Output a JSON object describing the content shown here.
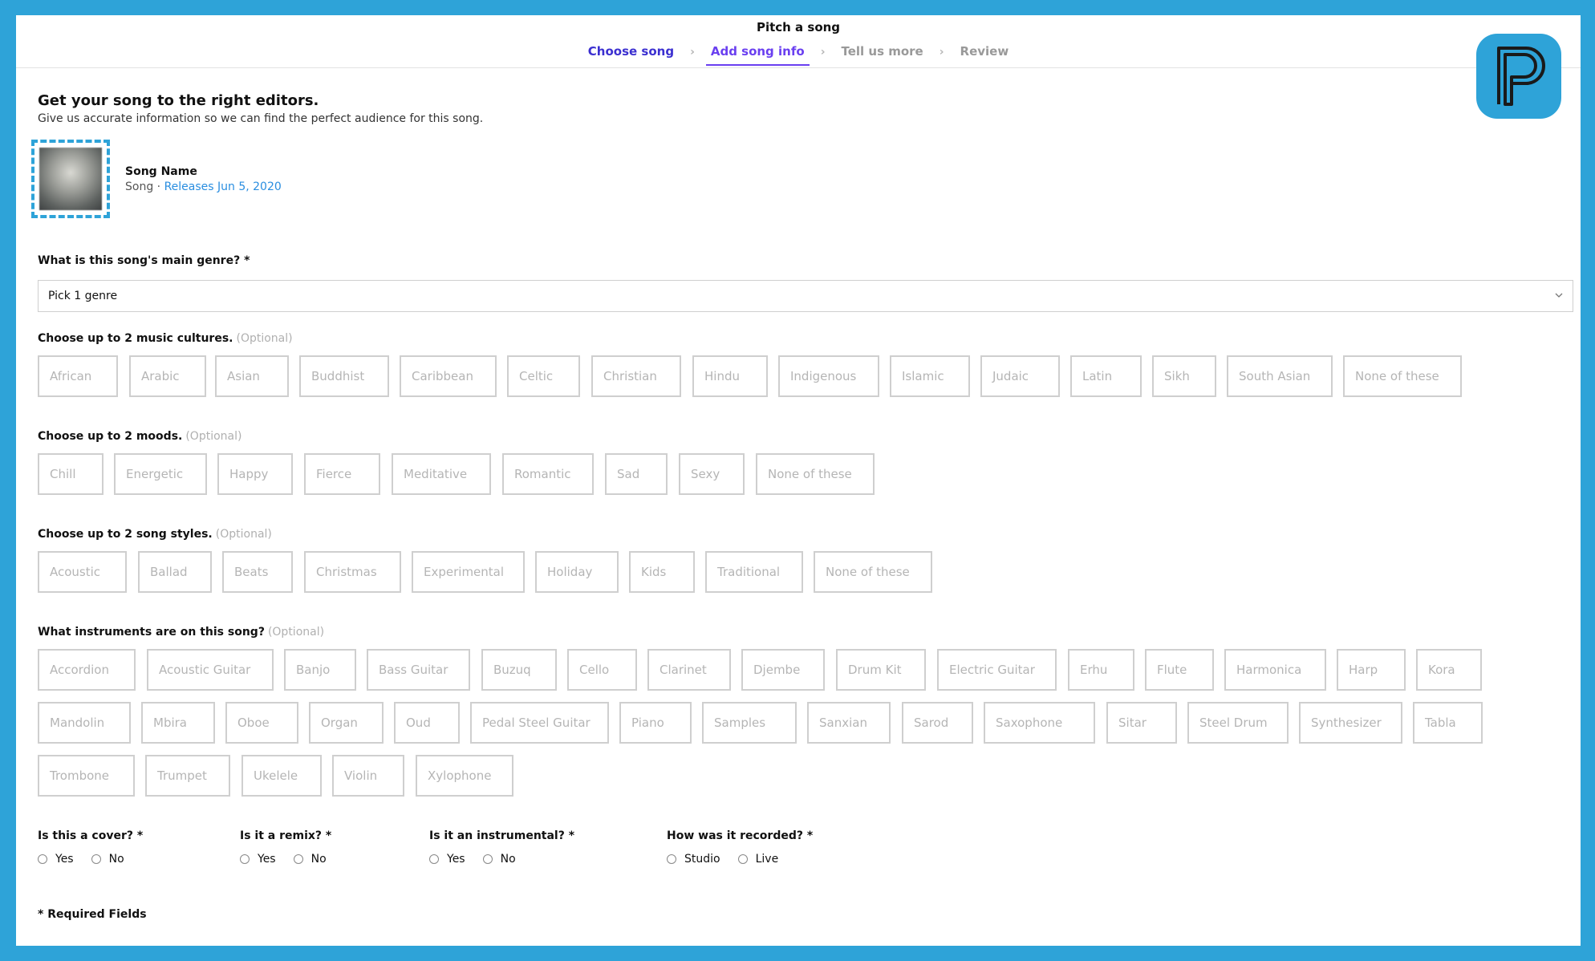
{
  "header": {
    "title": "Pitch a song",
    "steps": [
      {
        "label": "Choose song",
        "state": "done"
      },
      {
        "label": "Add song info",
        "state": "active"
      },
      {
        "label": "Tell us more",
        "state": "todo"
      },
      {
        "label": "Review",
        "state": "todo"
      }
    ]
  },
  "intro": {
    "heading": "Get your song to the right editors.",
    "subheading": "Give us accurate information so we can find the perfect audience for this song."
  },
  "song": {
    "name": "Song Name",
    "type": "Song · ",
    "release": "Releases Jun 5, 2020"
  },
  "genre": {
    "label": "What is this song's main genre? *",
    "placeholder": "Pick 1 genre"
  },
  "cultures": {
    "label": "Choose up to 2 music cultures.",
    "optional": "(Optional)",
    "options": [
      "African",
      "Arabic",
      "Asian",
      "Buddhist",
      "Caribbean",
      "Celtic",
      "Christian",
      "Hindu",
      "Indigenous",
      "Islamic",
      "Judaic",
      "Latin",
      "Sikh",
      "South Asian",
      "None of these"
    ]
  },
  "moods": {
    "label": "Choose up to 2 moods.",
    "optional": "(Optional)",
    "options": [
      "Chill",
      "Energetic",
      "Happy",
      "Fierce",
      "Meditative",
      "Romantic",
      "Sad",
      "Sexy",
      "None of these"
    ]
  },
  "styles": {
    "label": "Choose up to 2 song styles.",
    "optional": "(Optional)",
    "options": [
      "Acoustic",
      "Ballad",
      "Beats",
      "Christmas",
      "Experimental",
      "Holiday",
      "Kids",
      "Traditional",
      "None of these"
    ]
  },
  "instruments": {
    "label": "What instruments are on this song?",
    "optional": "(Optional)",
    "options": [
      "Accordion",
      "Acoustic Guitar",
      "Banjo",
      "Bass Guitar",
      "Buzuq",
      "Cello",
      "Clarinet",
      "Djembe",
      "Drum Kit",
      "Electric Guitar",
      "Erhu",
      "Flute",
      "Harmonica",
      "Harp",
      "Kora",
      "Mandolin",
      "Mbira",
      "Oboe",
      "Organ",
      "Oud",
      "Pedal Steel Guitar",
      "Piano",
      "Samples",
      "Sanxian",
      "Sarod",
      "Saxophone",
      "Sitar",
      "Steel Drum",
      "Synthesizer",
      "Tabla",
      "Trombone",
      "Trumpet",
      "Ukelele",
      "Violin",
      "Xylophone"
    ]
  },
  "questions": [
    {
      "label": "Is this a cover? *",
      "options": [
        "Yes",
        "No"
      ]
    },
    {
      "label": "Is it a remix? *",
      "options": [
        "Yes",
        "No"
      ]
    },
    {
      "label": "Is it an instrumental? *",
      "options": [
        "Yes",
        "No"
      ]
    },
    {
      "label": "How was it recorded? *",
      "options": [
        "Studio",
        "Live"
      ]
    }
  ],
  "footer": {
    "required_note": "* Required Fields"
  },
  "colors": {
    "accent": "#6a3ff0",
    "frame": "#2ea3d8",
    "link": "#2a8ee0"
  },
  "icons": {
    "brand": "brand-logo-icon",
    "dropdown": "chevron-down-icon"
  }
}
